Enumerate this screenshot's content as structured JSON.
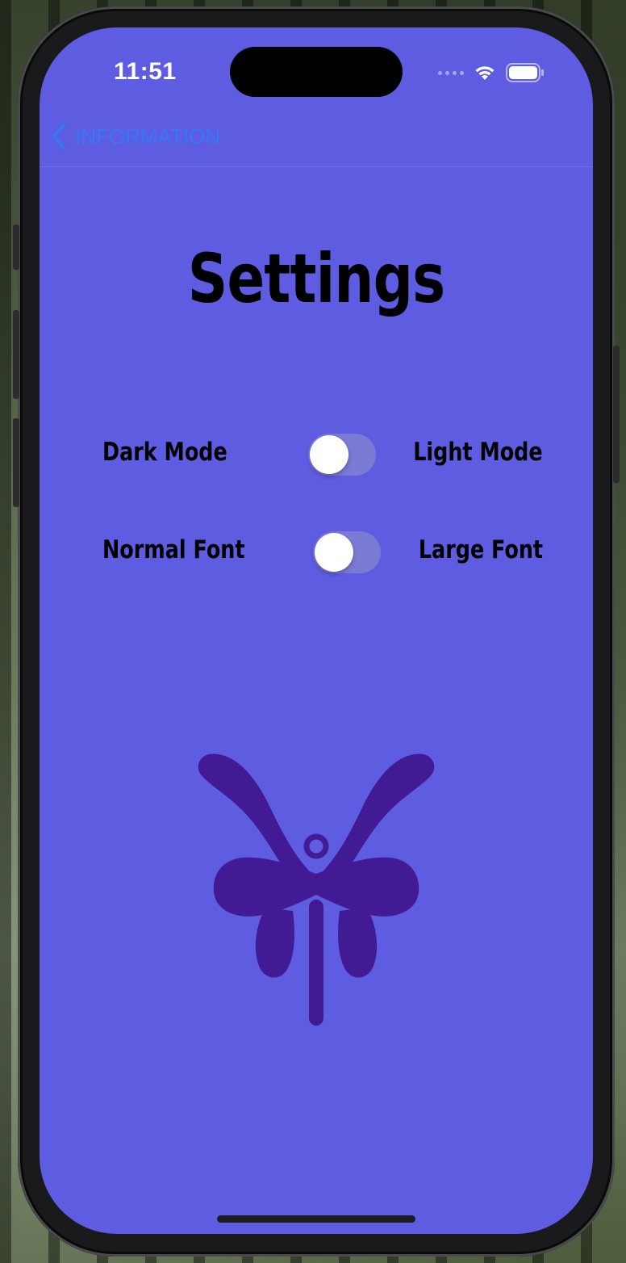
{
  "status_bar": {
    "time": "11:51"
  },
  "nav": {
    "back_label": "INFORMATION"
  },
  "page": {
    "title": "Settings"
  },
  "settings": [
    {
      "left_label": "Dark Mode",
      "right_label": "Light Mode",
      "toggle_on": false
    },
    {
      "left_label": "Normal Font",
      "right_label": "Large Font",
      "toggle_on": false
    }
  ],
  "colors": {
    "screen_background": "#5e5ce0",
    "back_link": "#3478f6",
    "logo": "#421a94"
  },
  "icons": {
    "back": "chevron-left-icon",
    "wifi": "wifi-icon",
    "battery": "battery-icon",
    "logo": "butterfly-logo-icon"
  }
}
